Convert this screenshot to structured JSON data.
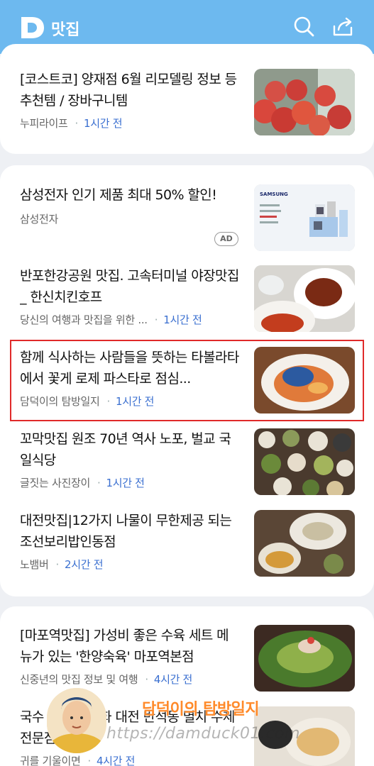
{
  "app": {
    "title": "맛집"
  },
  "header": {
    "logo_letter": "D",
    "search_icon": "search-icon",
    "share_icon": "share-icon"
  },
  "cards": [
    {
      "items": [
        {
          "title": "[코스트코] 양재점 6월 리모델링 정보 등 추천템 / 장바구니템",
          "source": "누피라이프",
          "time": "1시간 전"
        }
      ]
    },
    {
      "items": [
        {
          "title": "삼성전자 인기 제품 최대 50% 할인!",
          "source": "삼성전자",
          "ad": "AD"
        },
        {
          "title": "반포한강공원 맛집. 고속터미널 야장맛집_ 한신치킨호프",
          "source": "당신의 여행과 맛집을 위한 ...",
          "time": "1시간 전"
        },
        {
          "title": "함께 식사하는 사람들을 뜻하는 타볼라타에서 꽃게 로제 파스타로 점심...",
          "source": "담덕이의 탐방일지",
          "time": "1시간 전"
        },
        {
          "title": "꼬막맛집 원조 70년 역사 노포, 벌교 국일식당",
          "source": "글짓는 사진장이",
          "time": "1시간 전"
        },
        {
          "title": "대전맛집|12가지 나물이 무한제공 되는 조선보리밥인동점",
          "source": "노뱀버",
          "time": "2시간 전"
        }
      ]
    },
    {
      "items": [
        {
          "title": "[마포역맛집] 가성비 좋은 수육 세트 메뉴가 있는 '한양숙육' 마포역본점",
          "source": "신중년의 맛집 정보 및 여행",
          "time": "4시간 전"
        },
        {
          "title": "국수 환상의 조화 대전 반석동 멸치 수제 전문점",
          "source": "귀를 기울이면",
          "time": "4시간 전"
        }
      ]
    }
  ],
  "ad_image": {
    "brand": "SAMSUNG"
  },
  "watermark": {
    "title": "담덕이의 탐방일지",
    "url": "https://damduck01.com"
  },
  "colors": {
    "header": "#6db9ef",
    "time": "#3a6fd0",
    "highlight": "#e02a2a",
    "watermark": "#ff8a2a"
  }
}
